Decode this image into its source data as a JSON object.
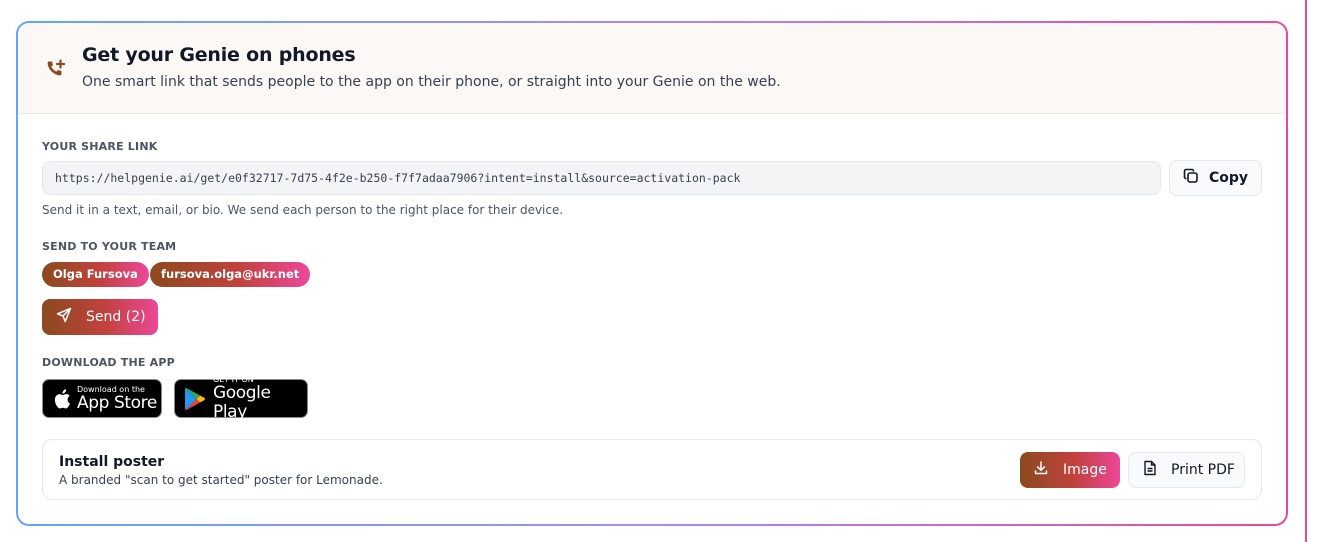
{
  "header": {
    "title": "Get your Genie on phones",
    "subtitle": "One smart link that sends people to the app on their phone, or straight into your Genie on the web.",
    "icon": "phone-plus-icon"
  },
  "share": {
    "label": "YOUR SHARE LINK",
    "url": "https://helpgenie.ai/get/e0f32717-7d75-4f2e-b250-f7f7adaa7906?intent=install&source=activation-pack",
    "copy_label": "Copy",
    "hint": "Send it in a text, email, or bio. We send each person to the right place for their device."
  },
  "team": {
    "label": "SEND TO YOUR TEAM",
    "recipients": [
      "Olga Fursova",
      "fursova.olga@ukr.net"
    ],
    "send_label": "Send (2)"
  },
  "download": {
    "label": "DOWNLOAD THE APP",
    "app_store": {
      "small": "Download on the",
      "big": "App Store"
    },
    "google_play": {
      "small": "GET IT ON",
      "big": "Google Play"
    }
  },
  "poster": {
    "title": "Install poster",
    "description": "A branded \"scan to get started\" poster for Lemonade.",
    "image_label": "Image",
    "pdf_label": "Print PDF"
  },
  "colors": {
    "accent_start": "#8b4a1e",
    "accent_end": "#ec4899",
    "border_start": "#60a5fa",
    "border_end": "#ec4899"
  }
}
